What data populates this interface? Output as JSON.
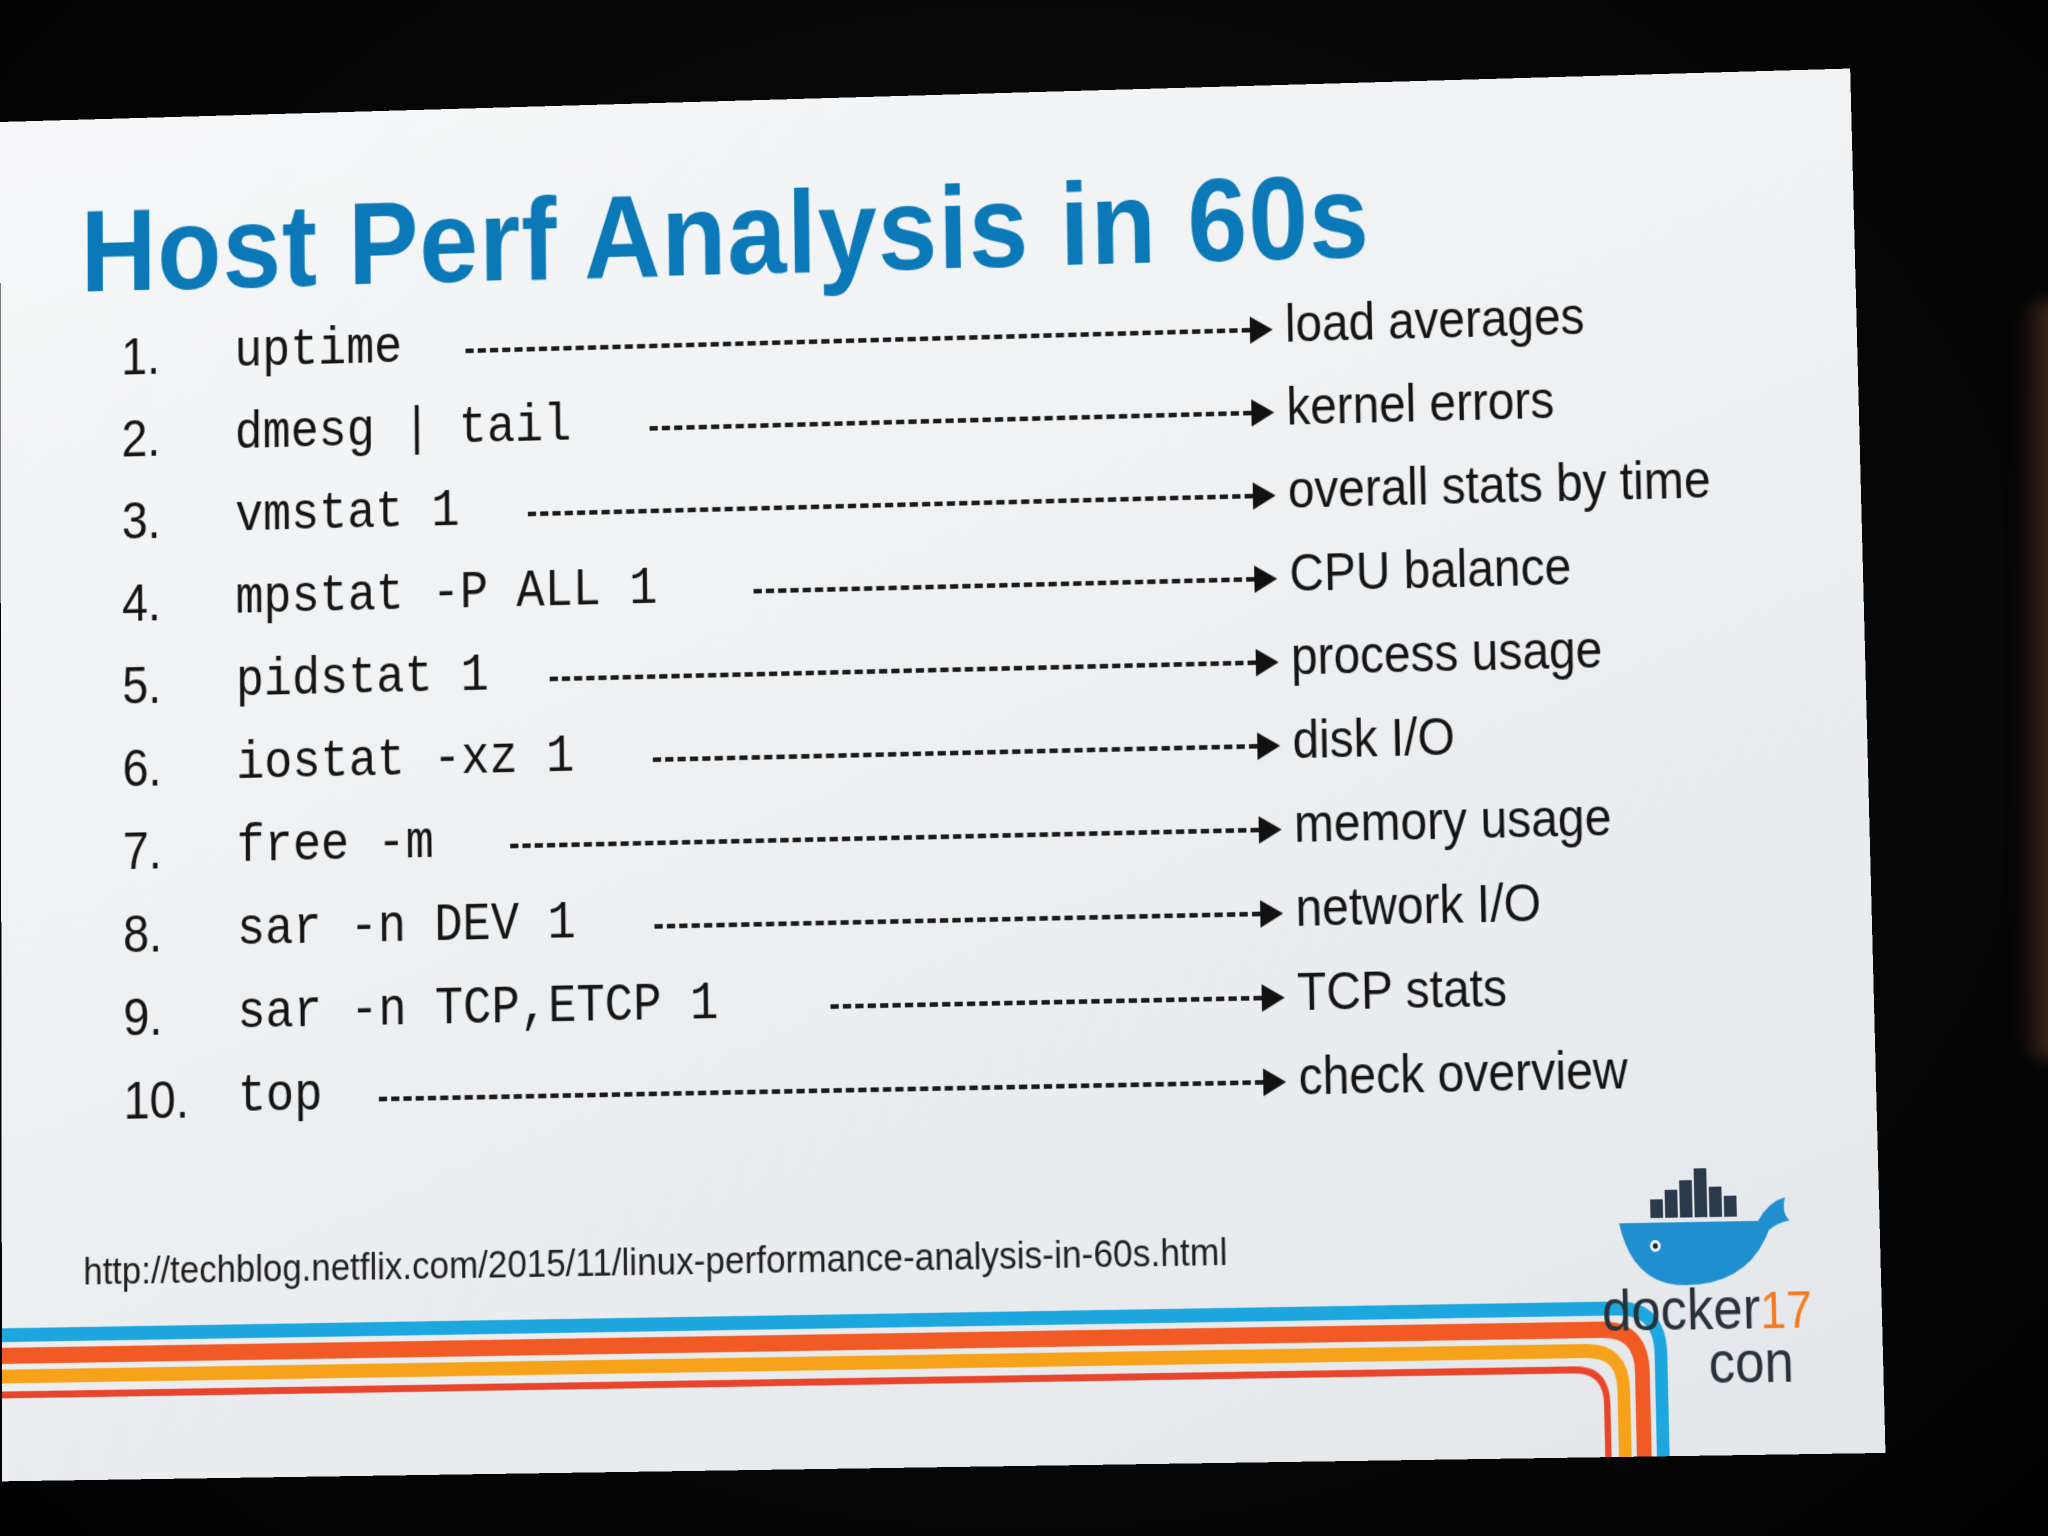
{
  "slide": {
    "title": "Host Perf Analysis in 60s",
    "commands": [
      {
        "num": "1.",
        "cmd": "uptime",
        "desc": "load averages"
      },
      {
        "num": "2.",
        "cmd": "dmesg | tail",
        "desc": "kernel errors"
      },
      {
        "num": "3.",
        "cmd": "vmstat 1",
        "desc": "overall stats by time"
      },
      {
        "num": "4.",
        "cmd": "mpstat -P ALL 1",
        "desc": "CPU balance"
      },
      {
        "num": "5.",
        "cmd": "pidstat 1",
        "desc": "process usage"
      },
      {
        "num": "6.",
        "cmd": "iostat -xz 1",
        "desc": "disk I/O"
      },
      {
        "num": "7.",
        "cmd": "free -m",
        "desc": "memory usage"
      },
      {
        "num": "8.",
        "cmd": "sar -n DEV 1",
        "desc": "network I/O"
      },
      {
        "num": "9.",
        "cmd": "sar -n TCP,ETCP 1",
        "desc": "TCP stats"
      },
      {
        "num": "10.",
        "cmd": "top",
        "desc": "check overview"
      }
    ],
    "source_url": "http://techblog.netflix.com/2015/11/linux-performance-analysis-in-60s.html",
    "logo": {
      "word": "docker",
      "year": "17",
      "word2": "con",
      "icon": "docker-whale-icon"
    },
    "colors": {
      "title": "#0b78b8",
      "stripe_blue": "#1ea7df",
      "stripe_orange": "#f15a24",
      "stripe_yellow": "#f7a21b",
      "whale": "#1f8fd0"
    }
  }
}
